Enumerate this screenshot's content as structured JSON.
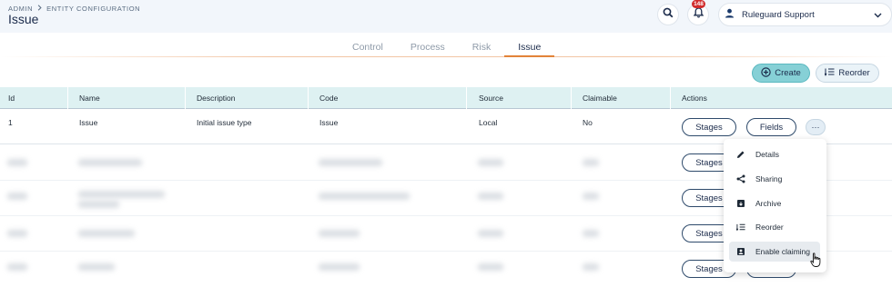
{
  "breadcrumb": {
    "root": "ADMIN",
    "current": "ENTITY CONFIGURATION"
  },
  "page": {
    "title": "Issue"
  },
  "header": {
    "notifications_count": "148",
    "user_name": "Ruleguard Support"
  },
  "tabs": [
    {
      "label": "Control",
      "active": false
    },
    {
      "label": "Process",
      "active": false
    },
    {
      "label": "Risk",
      "active": false
    },
    {
      "label": "Issue",
      "active": true
    }
  ],
  "toolbar": {
    "create_label": "Create",
    "reorder_label": "Reorder"
  },
  "table": {
    "columns": [
      "Id",
      "Name",
      "Description",
      "Code",
      "Source",
      "Claimable",
      "Actions"
    ],
    "rows": [
      {
        "id": "1",
        "name": "Issue",
        "description": "Initial issue type",
        "code": "Issue",
        "source": "Local",
        "claimable": "No"
      }
    ],
    "row_actions": {
      "stages_label": "Stages",
      "fields_label": "Fields",
      "more_label": "···"
    }
  },
  "menu": {
    "items": [
      {
        "label": "Details",
        "icon": "pencil-icon"
      },
      {
        "label": "Sharing",
        "icon": "share-icon"
      },
      {
        "label": "Archive",
        "icon": "archive-icon"
      },
      {
        "label": "Reorder",
        "icon": "reorder-icon"
      },
      {
        "label": "Enable claiming",
        "icon": "claim-icon",
        "hovered": true
      }
    ]
  },
  "colors": {
    "accent": "#86d0d6",
    "tab_underline": "#e07a2a",
    "badge": "#d12c2c",
    "header_row": "#def1f2"
  }
}
